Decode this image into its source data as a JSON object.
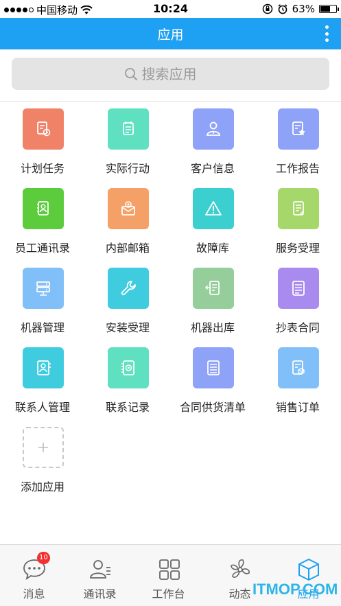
{
  "status": {
    "carrier": "中国移动",
    "time": "10:24",
    "battery": "63%",
    "battery_level": 0.63
  },
  "header": {
    "title": "应用"
  },
  "search": {
    "placeholder": "搜索应用"
  },
  "apps": [
    {
      "label": "计划任务",
      "color": "#f08267",
      "icon": "plan-task-icon"
    },
    {
      "label": "实际行动",
      "color": "#5fe0c0",
      "icon": "actual-action-icon"
    },
    {
      "label": "客户信息",
      "color": "#8ea2f7",
      "icon": "customer-info-icon"
    },
    {
      "label": "工作报告",
      "color": "#8ea2f7",
      "icon": "work-report-icon"
    },
    {
      "label": "员工通讯录",
      "color": "#5ccc3c",
      "icon": "employee-contacts-icon"
    },
    {
      "label": "内部邮箱",
      "color": "#f5a066",
      "icon": "internal-mail-icon"
    },
    {
      "label": "故障库",
      "color": "#3ccfd0",
      "icon": "fault-library-icon"
    },
    {
      "label": "服务受理",
      "color": "#a5d76a",
      "icon": "service-acceptance-icon"
    },
    {
      "label": "机器管理",
      "color": "#80bff7",
      "icon": "machine-manage-icon"
    },
    {
      "label": "安装受理",
      "color": "#40ccdf",
      "icon": "install-acceptance-icon"
    },
    {
      "label": "机器出库",
      "color": "#95cd9b",
      "icon": "machine-outbound-icon"
    },
    {
      "label": "抄表合同",
      "color": "#a98bf0",
      "icon": "meter-contract-icon"
    },
    {
      "label": "联系人管理",
      "color": "#40ccdf",
      "icon": "contact-manage-icon"
    },
    {
      "label": "联系记录",
      "color": "#5fe0c0",
      "icon": "contact-record-icon"
    },
    {
      "label": "合同供货清单",
      "color": "#8ea2f7",
      "icon": "contract-supply-icon"
    },
    {
      "label": "销售订单",
      "color": "#80bff7",
      "icon": "sales-order-icon"
    },
    {
      "label": "添加应用",
      "color": "#ffffff",
      "icon": "add-icon"
    }
  ],
  "nav": [
    {
      "label": "消息",
      "icon": "message-icon",
      "badge": "10"
    },
    {
      "label": "通讯录",
      "icon": "contacts-icon"
    },
    {
      "label": "工作台",
      "icon": "workbench-icon"
    },
    {
      "label": "动态",
      "icon": "activity-icon"
    },
    {
      "label": "应用",
      "icon": "apps-cube-icon",
      "active": true
    }
  ],
  "watermark": "ITMOP.COM",
  "colors": {
    "primary": "#1ea0f3",
    "badge": "#f23030"
  }
}
